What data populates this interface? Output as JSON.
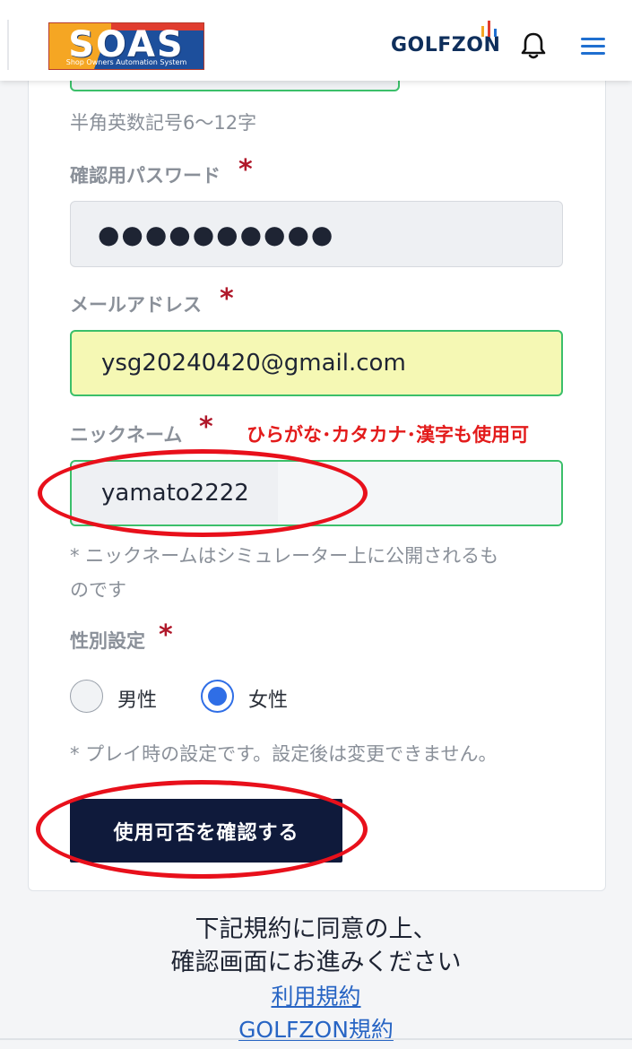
{
  "header": {
    "logo_text": "SOAS",
    "logo_sub": "Shop Owners Automation System",
    "brand": "GOLFZON",
    "bell_icon": "bell-icon",
    "menu_icon": "hamburger-menu-icon",
    "colors": {
      "brand_navy": "#0f2f5c",
      "menu_blue": "#1f6fd0"
    }
  },
  "form": {
    "password_hint": "半角英数記号6〜12字",
    "confirm_password": {
      "label": "確認用パスワード",
      "required_mark": "*",
      "value": "●●●●●●●●●●"
    },
    "email": {
      "label": "メールアドレス",
      "required_mark": "*",
      "value": "ysg20240420@gmail.com"
    },
    "nickname": {
      "label": "ニックネーム",
      "required_mark": "*",
      "annotation": "ひらがな･カタカナ･漢字も使用可",
      "value": "yamato2222",
      "note_line1": "* ニックネームはシミュレーター上に公開されるも",
      "note_line2": "のです"
    },
    "gender": {
      "label": "性別設定",
      "required_mark": "*",
      "options": [
        {
          "label": "男性",
          "selected": false
        },
        {
          "label": "女性",
          "selected": true
        }
      ],
      "note": "* プレイ時の設定です。設定後は変更できません。"
    },
    "check_button": "使用可否を確認する"
  },
  "footer": {
    "line1": "下記規約に同意の上、",
    "line2": "確認画面にお進みください",
    "link_terms": "利用規約",
    "link_golfzon_terms": "GOLFZON規約"
  },
  "colors": {
    "accent_green": "#3bbf6a",
    "required_red": "#b0182a",
    "annotation_red": "#e31b1b",
    "radio_blue": "#2f6ee6",
    "button_navy": "#0f1a3b"
  }
}
